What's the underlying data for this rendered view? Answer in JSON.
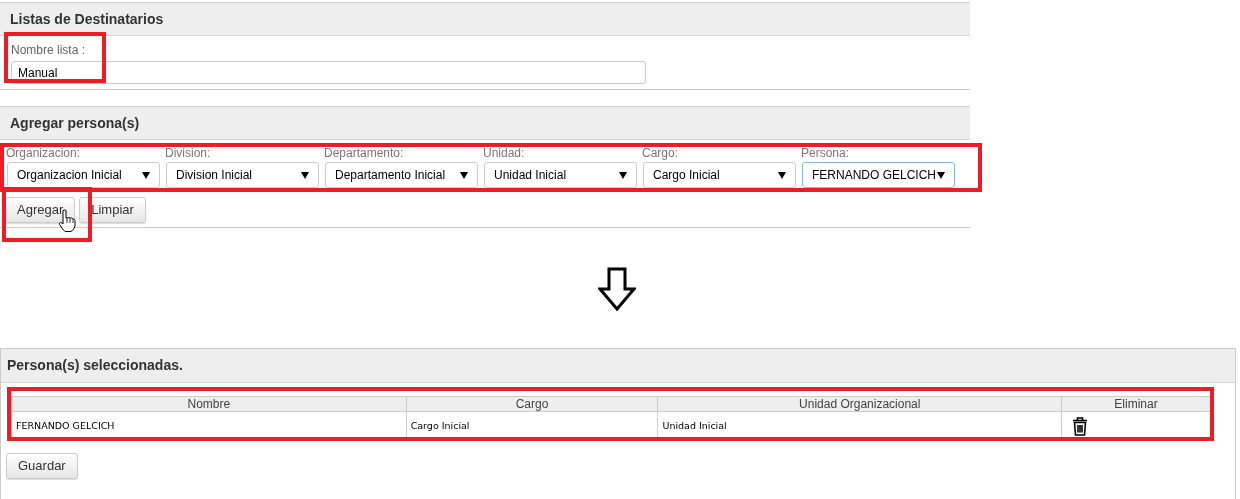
{
  "list_panel": {
    "title": "Listas de Destinatarios",
    "field": {
      "label": "Nombre lista :",
      "value": "Manual"
    }
  },
  "add_panel": {
    "title": "Agregar persona(s)",
    "selects": [
      {
        "label": "Organizacion:",
        "value": "Organizacion Inicial",
        "focused": false
      },
      {
        "label": "Division:",
        "value": "Division Inicial",
        "focused": false
      },
      {
        "label": "Departamento:",
        "value": "Departamento Inicial",
        "focused": false
      },
      {
        "label": "Unidad:",
        "value": "Unidad Inicial",
        "focused": false
      },
      {
        "label": "Cargo:",
        "value": "Cargo Inicial",
        "focused": false
      },
      {
        "label": "Persona:",
        "value": "FERNANDO GELCICH",
        "focused": true
      }
    ],
    "buttons": [
      "Agregar",
      "Limpiar"
    ]
  },
  "selected_panel": {
    "title": "Persona(s) seleccionadas.",
    "table": {
      "columns": [
        "Nombre",
        "Cargo",
        "Unidad Organizacional",
        "Eliminar"
      ],
      "rows": [
        {
          "cells": [
            "FERNANDO GELCICH",
            "Cargo Inicial",
            "Unidad Inicial"
          ]
        }
      ]
    },
    "buttons": [
      "Guardar"
    ]
  }
}
